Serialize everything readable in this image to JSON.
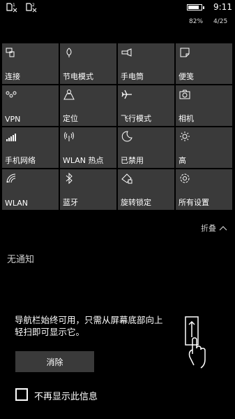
{
  "status": {
    "time": "9:11",
    "battery_percent": "82%",
    "battery_level": 0.82,
    "date": "4/25",
    "sim_icons": [
      "sim1-no-signal-icon",
      "sim2-no-signal-icon"
    ]
  },
  "tiles": [
    {
      "label": "连接",
      "icon": "connect-icon"
    },
    {
      "label": "节电模式",
      "icon": "battery-saver-icon"
    },
    {
      "label": "手电筒",
      "icon": "flashlight-icon"
    },
    {
      "label": "便笺",
      "icon": "note-icon"
    },
    {
      "label": "VPN",
      "icon": "vpn-icon"
    },
    {
      "label": "定位",
      "icon": "location-icon"
    },
    {
      "label": "飞行模式",
      "icon": "airplane-icon"
    },
    {
      "label": "相机",
      "icon": "camera-icon"
    },
    {
      "label": "手机网络",
      "icon": "cellular-icon"
    },
    {
      "label": "WLAN 热点",
      "icon": "hotspot-icon"
    },
    {
      "label": "已禁用",
      "icon": "quiet-hours-icon"
    },
    {
      "label": "高",
      "icon": "brightness-icon"
    },
    {
      "label": "WLAN",
      "icon": "wifi-icon"
    },
    {
      "label": "蓝牙",
      "icon": "bluetooth-icon"
    },
    {
      "label": "旋转锁定",
      "icon": "rotation-lock-icon"
    },
    {
      "label": "所有设置",
      "icon": "settings-icon"
    }
  ],
  "collapse_label": "折叠",
  "no_notifications": "无通知",
  "nav_hint": "导航栏始终可用，只需从屏幕底部向上轻扫即可显示它。",
  "dismiss_label": "消除",
  "dont_show_label": "不再显示此信息"
}
